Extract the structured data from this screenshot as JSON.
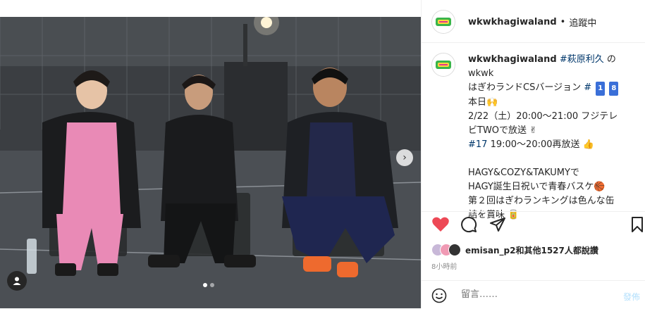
{
  "post": {
    "username": "wkwkhagiwaland",
    "separator": "•",
    "follow_status": "追蹤中"
  },
  "caption": {
    "username": "wkwkhagiwaland",
    "hashtag1": "#萩原利久",
    "line1_rest": "のwkwk",
    "line2_text": "はぎわランドCSバージョン",
    "hashtag2": "#",
    "badge1": "1",
    "badge2": "8",
    "line3": "本日🙌",
    "line4": "2/22（土）20:00～21:00 フジテレ",
    "line5": "ビTWOで放送 ✌",
    "hashtag3": "#17",
    "line6_rest": "19:00～20:00再放送 👍",
    "line7": "HAGY&COZY&TAKUMYで",
    "line8": "HAGY誕生日祝いで青春バスケ🏀",
    "line9": "第２回はぎわランキングは色んな缶",
    "line10": "詰を賞味 🥫"
  },
  "likes": {
    "user": "emisan_p2",
    "text": "和其他1527人都說讚"
  },
  "time": "8小時前",
  "comment": {
    "placeholder": "留言……",
    "post_label": "發佈"
  },
  "icons": {
    "heart": "heart-icon",
    "comment": "comment-icon",
    "share": "send-icon",
    "save": "bookmark-icon",
    "emoji": "emoji-icon",
    "next": "chevron-right-icon",
    "tag": "user-tag-icon"
  },
  "colors": {
    "like_red": "#ed4956",
    "link_blue": "#00376b",
    "text": "#262626",
    "muted": "#8e8e8e"
  },
  "carousel": {
    "count": 2,
    "active": 1
  }
}
